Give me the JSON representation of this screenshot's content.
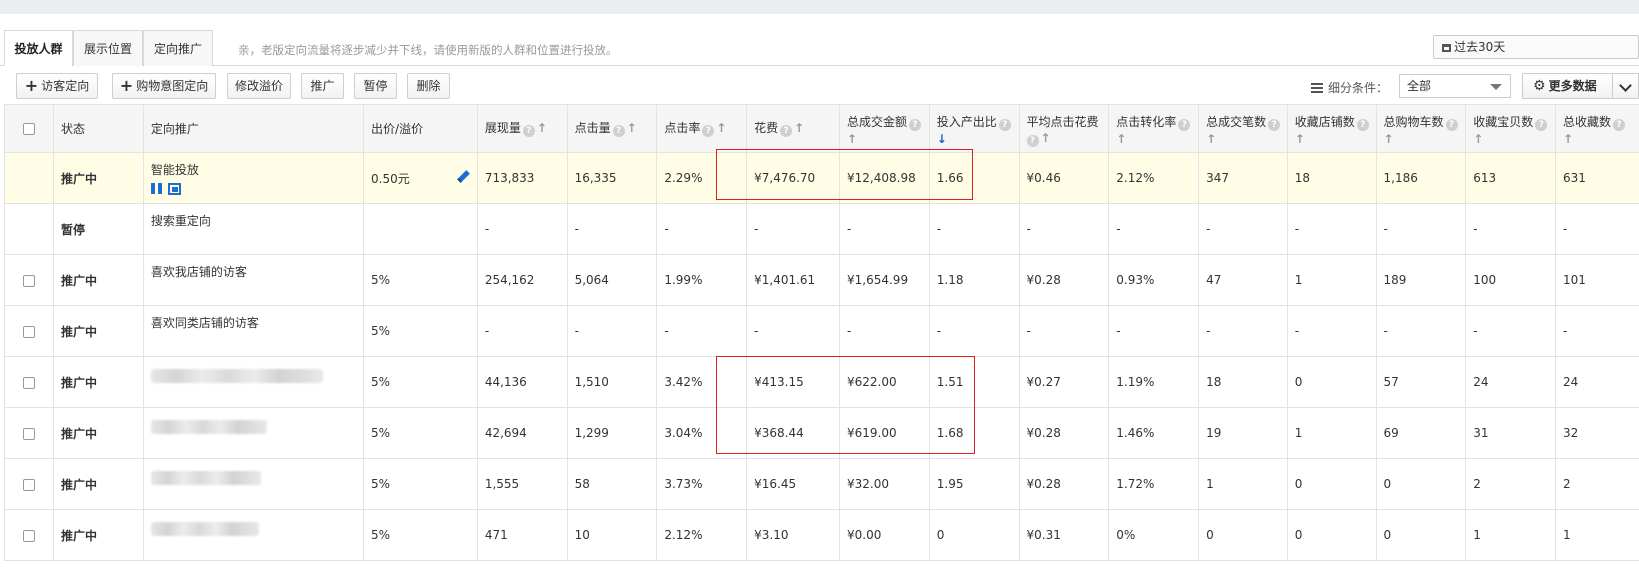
{
  "tabs": [
    "投放人群",
    "展示位置",
    "定向推广"
  ],
  "tab_note": "亲，老版定向流量将逐步减少并下线，请使用新版的人群和位置进行投放。",
  "date_range": "过去30天",
  "toolbar": {
    "buttons": [
      "访客定向",
      "购物意图定向",
      "修改溢价",
      "推广",
      "暂停",
      "删除"
    ],
    "filter_label": "细分条件：",
    "filter_value": "全部",
    "more_data": "更多数据"
  },
  "columns": [
    {
      "label": ""
    },
    {
      "label": "状态"
    },
    {
      "label": "定向推广"
    },
    {
      "label": "出价/溢价"
    },
    {
      "label": "展现量"
    },
    {
      "label": "点击量"
    },
    {
      "label": "点击率"
    },
    {
      "label": "花费"
    },
    {
      "label": "总成交金额"
    },
    {
      "label": "投入产出比"
    },
    {
      "label": "平均点击花费"
    },
    {
      "label": "点击转化率"
    },
    {
      "label": "总成交笔数"
    },
    {
      "label": "收藏店铺数"
    },
    {
      "label": "总购物车数"
    },
    {
      "label": "收藏宝贝数"
    },
    {
      "label": "总收藏数"
    }
  ],
  "rows": [
    {
      "status": "推广中",
      "status_type": "on",
      "name": "智能投放",
      "bid": "0.50元",
      "impressions": "713,833",
      "clicks": "16,335",
      "ctr": "2.29%",
      "cost": "¥7,476.70",
      "gmv": "¥12,408.98",
      "roi": "1.66",
      "cpc": "¥0.46",
      "cvr": "2.12%",
      "orders": "347",
      "shop_fav": "18",
      "cart": "1,186",
      "item_fav": "613",
      "total_fav": "631"
    },
    {
      "status": "暂停",
      "status_type": "off",
      "name": "搜索重定向",
      "bid": "",
      "impressions": "-",
      "clicks": "-",
      "ctr": "-",
      "cost": "-",
      "gmv": "-",
      "roi": "-",
      "cpc": "-",
      "cvr": "-",
      "orders": "-",
      "shop_fav": "-",
      "cart": "-",
      "item_fav": "-",
      "total_fav": "-"
    },
    {
      "status": "推广中",
      "status_type": "on",
      "name": "喜欢我店铺的访客",
      "bid": "5%",
      "impressions": "254,162",
      "clicks": "5,064",
      "ctr": "1.99%",
      "cost": "¥1,401.61",
      "gmv": "¥1,654.99",
      "roi": "1.18",
      "cpc": "¥0.28",
      "cvr": "0.93%",
      "orders": "47",
      "shop_fav": "1",
      "cart": "189",
      "item_fav": "100",
      "total_fav": "101"
    },
    {
      "status": "推广中",
      "status_type": "on",
      "name": "喜欢同类店铺的访客",
      "bid": "5%",
      "impressions": "-",
      "clicks": "-",
      "ctr": "-",
      "cost": "-",
      "gmv": "-",
      "roi": "-",
      "cpc": "-",
      "cvr": "-",
      "orders": "-",
      "shop_fav": "-",
      "cart": "-",
      "item_fav": "-",
      "total_fav": "-"
    },
    {
      "status": "推广中",
      "status_type": "on",
      "name": "",
      "bid": "5%",
      "impressions": "44,136",
      "clicks": "1,510",
      "ctr": "3.42%",
      "cost": "¥413.15",
      "gmv": "¥622.00",
      "roi": "1.51",
      "cpc": "¥0.27",
      "cvr": "1.19%",
      "orders": "18",
      "shop_fav": "0",
      "cart": "57",
      "item_fav": "24",
      "total_fav": "24"
    },
    {
      "status": "推广中",
      "status_type": "on",
      "name": "",
      "bid": "5%",
      "impressions": "42,694",
      "clicks": "1,299",
      "ctr": "3.04%",
      "cost": "¥368.44",
      "gmv": "¥619.00",
      "roi": "1.68",
      "cpc": "¥0.28",
      "cvr": "1.46%",
      "orders": "19",
      "shop_fav": "1",
      "cart": "69",
      "item_fav": "31",
      "total_fav": "32"
    },
    {
      "status": "推广中",
      "status_type": "on",
      "name": "",
      "bid": "5%",
      "impressions": "1,555",
      "clicks": "58",
      "ctr": "3.73%",
      "cost": "¥16.45",
      "gmv": "¥32.00",
      "roi": "1.95",
      "cpc": "¥0.28",
      "cvr": "1.72%",
      "orders": "1",
      "shop_fav": "0",
      "cart": "0",
      "item_fav": "2",
      "total_fav": "2"
    },
    {
      "status": "推广中",
      "status_type": "on",
      "name": "",
      "bid": "5%",
      "impressions": "471",
      "clicks": "10",
      "ctr": "2.12%",
      "cost": "¥3.10",
      "gmv": "¥0.00",
      "roi": "0",
      "cpc": "¥0.31",
      "cvr": "0%",
      "orders": "0",
      "shop_fav": "0",
      "cart": "0",
      "item_fav": "1",
      "total_fav": "1"
    }
  ],
  "colors": {
    "status_on": "#1e8c1e",
    "status_off": "#ef8c16",
    "highlight_row": "#fffde6",
    "annotation_box": "#e02020",
    "accent": "#1a6fd1"
  }
}
